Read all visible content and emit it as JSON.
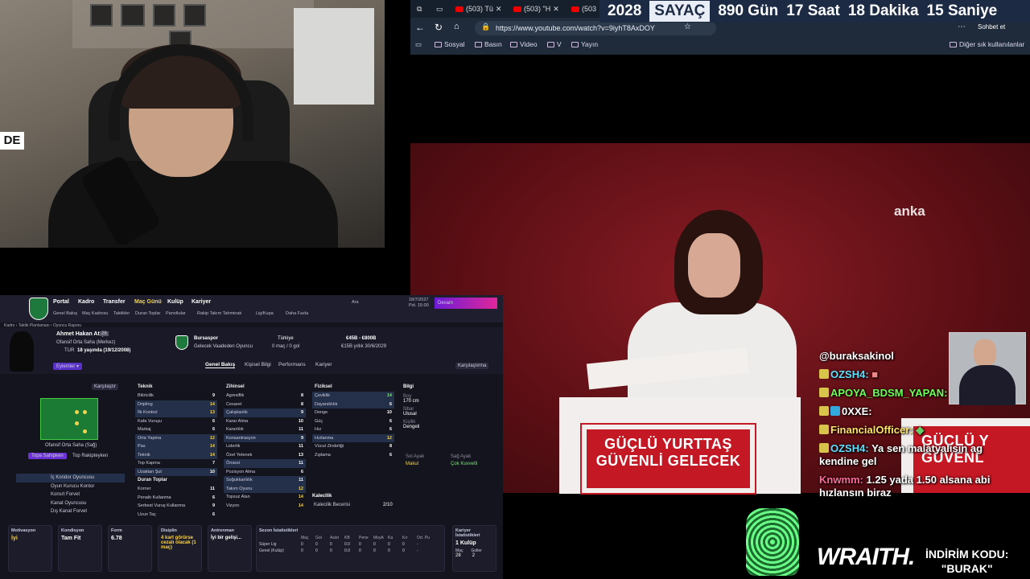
{
  "webcam": {
    "logo_text": "DE"
  },
  "browser": {
    "tabs": [
      "(503) Tü",
      "(503) \"H",
      "(503"
    ],
    "url": "https://www.youtube.com/watch?v=9iyhT8AxDOY",
    "profile_button": "Sohbet et",
    "bookmarks": [
      "Sosyal",
      "Basın",
      "Video",
      "V",
      "Yayın"
    ],
    "other_bookmarks": "Diğer sık kullanılanlar"
  },
  "countdown": {
    "year": "2028",
    "label": "SAYAÇ",
    "days": "890 Gün",
    "hours": "17 Saat",
    "minutes": "18 Dakika",
    "seconds": "15 Saniye"
  },
  "video": {
    "watermark": "anka",
    "slogan_line1": "GÜÇLÜ YURTTAŞ",
    "slogan_line2": "GÜVENLİ GELECEK",
    "slogan2_line1": "GÜÇLÜ Y",
    "slogan2_line2": "GÜVENL"
  },
  "chat": {
    "messages": [
      {
        "user": "@buraksakinol",
        "text": ""
      },
      {
        "user": "OZSH4:",
        "text": ""
      },
      {
        "user": "APOYA_BDSM_YAPAN:",
        "text": ""
      },
      {
        "user": "0XXE:",
        "text": ""
      },
      {
        "user": "FinancialOfficer:",
        "text": ""
      },
      {
        "user": "OZSH4:",
        "text": "Ya sen malatyalısın ag kendine gel"
      },
      {
        "user": "Knwmm:",
        "text": "1.25 yada 1.50 alsana abi hızlansın biraz"
      }
    ]
  },
  "sponsor": {
    "brand": "WRAITH.",
    "promo_line1": "İNDİRİM KODU:",
    "promo_line2": "\"BURAK\""
  },
  "fm": {
    "nav": [
      "Portal",
      "Kadro",
      "Transfer",
      "Maç Günü",
      "Kulüp",
      "Kariyer"
    ],
    "subnav": [
      "Genel Bakış",
      "Maç Kadrosu",
      "Taktikler",
      "Duran Toplar",
      "Panoltular",
      "Rakip Takım Tahminatı",
      "Lig/Kupa",
      "Daha Fazla"
    ],
    "search": "Ara",
    "date": "18/7/2027",
    "day": "Pzt. 15:00",
    "promo_button": "Devam",
    "breadcrumb": "Kadro › Taktik Planlaması › Oyuncu Raporu",
    "player": {
      "name": "Ahmet Hakan Atış",
      "number": "26",
      "position": "Ofansif Orta Saha (Merkez)",
      "nation": "TUR",
      "age": "18 yaşında (19/12/2008)",
      "club": "Bursaspor",
      "club_sub": "Gelecek Vaadeden Oyuncu",
      "country": "Türkiye",
      "caps": "0 maç / 0 gol",
      "value": "€45B - €800B",
      "wage": "€15B yıllık 30/6/2029",
      "actions": "Eylemler"
    },
    "tabs": [
      "Genel Bakış",
      "Kişisel Bilgi",
      "Performans",
      "Kariyer"
    ],
    "compare_button": "Karşılaştırma",
    "compare_small": "Karşılaştır",
    "position_label": "Ofansif Orta Saha (Sağ)",
    "role_tabs": [
      "Topa Sahipken",
      "Top Rakipteyken"
    ],
    "roles": [
      "İç Koridor Oyuncusu",
      "Oyun Kurucu Kontor",
      "Konsrt Forvet",
      "Kanat Oyuncusu",
      "Dış Kanat Forvet"
    ],
    "technical": {
      "title": "Teknik",
      "rows": [
        [
          "Bitiricilik",
          "9"
        ],
        [
          "Dripling",
          "14"
        ],
        [
          "İlk Kontrol",
          "13"
        ],
        [
          "Kafa Vuruşu",
          "6"
        ],
        [
          "Markaj",
          "6"
        ],
        [
          "Orta Yapma",
          "12"
        ],
        [
          "Pas",
          "14"
        ],
        [
          "Teknik",
          "14"
        ],
        [
          "Top Kapma",
          "7"
        ],
        [
          "Uzaktan Şut",
          "10"
        ]
      ]
    },
    "set_pieces": {
      "title": "Duran Toplar",
      "rows": [
        [
          "Korner",
          "11"
        ],
        [
          "Penaltı Kullanma",
          "6"
        ],
        [
          "Serbest Vuruş Kullanma",
          "9"
        ],
        [
          "Uzun Taç",
          "6"
        ]
      ]
    },
    "mental": {
      "title": "Zihinsel",
      "rows": [
        [
          "Agresiflik",
          "8"
        ],
        [
          "Cesaret",
          "8"
        ],
        [
          "Çalışkanlık",
          "9"
        ],
        [
          "Karar Alma",
          "10"
        ],
        [
          "Kararlılık",
          "11"
        ],
        [
          "Konsantrasyon",
          "9"
        ],
        [
          "Liderlik",
          "11"
        ],
        [
          "Özel Yetenek",
          "13"
        ],
        [
          "Önsezi",
          "11"
        ],
        [
          "Pozisyon Alma",
          "6"
        ],
        [
          "Soğukkanlılık",
          "11"
        ],
        [
          "Takım Oyunu",
          "12"
        ],
        [
          "Topsuz Alan",
          "14"
        ],
        [
          "Vizyon",
          "14"
        ]
      ]
    },
    "physical": {
      "title": "Fiziksel",
      "rows": [
        [
          "Çeviklik",
          "14"
        ],
        [
          "Dayanıklılık",
          "6"
        ],
        [
          "Denge",
          "10"
        ],
        [
          "Güç",
          "6"
        ],
        [
          "Hız",
          "6"
        ],
        [
          "Hızlanma",
          "12"
        ],
        [
          "Vücut Zindeliği",
          "8"
        ],
        [
          "Zıplama",
          "6"
        ]
      ]
    },
    "info": {
      "title": "Bilgi",
      "height_label": "Boy",
      "height": "170 cm",
      "ability_label": "İtibar",
      "ability": "Ulusal",
      "personality_label": "Kişilik",
      "personality": "Dengeli"
    },
    "foot": {
      "left": "Sol Ayak",
      "left_val": "Makul",
      "right": "Sağ Ayak",
      "right_val": "Çok Kuvvetli"
    },
    "consistency": {
      "label": "Kalecilik",
      "value": "Kalecilik Becerisi",
      "score": "2/10"
    },
    "boxes": [
      {
        "title": "Motivasyon",
        "value": "İyi"
      },
      {
        "title": "Kondisyon",
        "value": "Tam Fit"
      },
      {
        "title": "Form",
        "value": "6.78"
      },
      {
        "title": "Disiplin",
        "value": "4 kart görürse cezalı olacak (1 maç)"
      },
      {
        "title": "Antrenman",
        "value": "İyi bir gelişi..."
      },
      {
        "title": "Sezon İstatistikleri",
        "value": ""
      },
      {
        "title": "Kariyer İstatistikleri",
        "value": "1 Kulüp"
      }
    ],
    "season_cols": [
      "Maç",
      "Gol",
      "Asist",
      "KB",
      "Pene",
      "MoyA",
      "Ka",
      "Kır",
      "Ort. Pu"
    ],
    "season_rows": [
      {
        "label": "Süper Lig",
        "values": [
          "0",
          "0",
          "0",
          "0.0",
          "0",
          "0",
          "0",
          "0",
          "-"
        ]
      },
      {
        "label": "Genel (Kulüp)",
        "values": [
          "0",
          "0",
          "0",
          "0.0",
          "0",
          "0",
          "0",
          "0",
          "-"
        ]
      }
    ],
    "career": {
      "matches_label": "Maç",
      "matches": "28",
      "goals_label": "Goller",
      "goals": "2"
    }
  }
}
